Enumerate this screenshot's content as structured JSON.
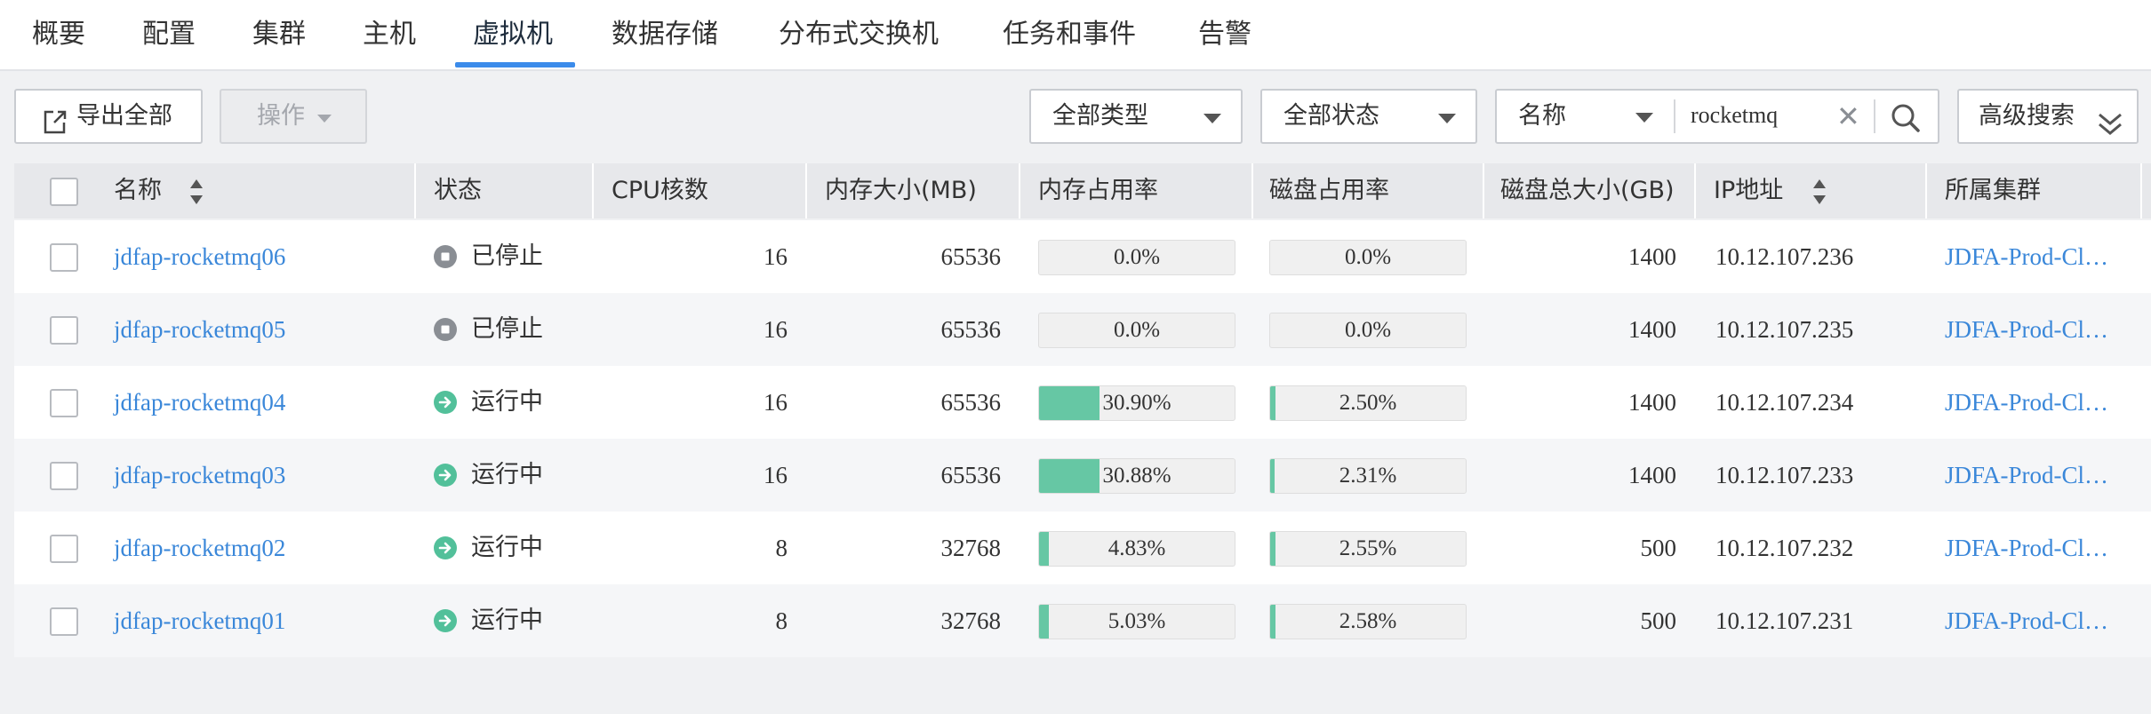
{
  "tabs": [
    "概要",
    "配置",
    "集群",
    "主机",
    "虚拟机",
    "数据存储",
    "分布式交换机",
    "任务和事件",
    "告警"
  ],
  "toolbar": {
    "export_label": "导出全部",
    "operate_label": "操作",
    "type_filter": "全部类型",
    "status_filter": "全部状态",
    "search_field": "名称",
    "search_value": "rocketmq",
    "advanced_search": "高级搜索"
  },
  "table": {
    "headers": [
      "名称",
      "状态",
      "CPU核数",
      "内存大小(MB)",
      "内存占用率",
      "磁盘占用率",
      "磁盘总大小(GB)",
      "IP地址",
      "所属集群"
    ],
    "rows": [
      {
        "name": "jdfap-rocketmq06",
        "status": "已停止",
        "state": "stopped",
        "cpu": "16",
        "mem": "65536",
        "mem_usage": "0.0%",
        "mem_pct": 0,
        "disk_usage": "0.0%",
        "disk_pct": 0,
        "disk_total": "1400",
        "ip": "10.12.107.236",
        "cluster": "JDFA-Prod-Cl…"
      },
      {
        "name": "jdfap-rocketmq05",
        "status": "已停止",
        "state": "stopped",
        "cpu": "16",
        "mem": "65536",
        "mem_usage": "0.0%",
        "mem_pct": 0,
        "disk_usage": "0.0%",
        "disk_pct": 0,
        "disk_total": "1400",
        "ip": "10.12.107.235",
        "cluster": "JDFA-Prod-Cl…"
      },
      {
        "name": "jdfap-rocketmq04",
        "status": "运行中",
        "state": "running",
        "cpu": "16",
        "mem": "65536",
        "mem_usage": "30.90%",
        "mem_pct": 30.9,
        "disk_usage": "2.50%",
        "disk_pct": 2.5,
        "disk_total": "1400",
        "ip": "10.12.107.234",
        "cluster": "JDFA-Prod-Cl…"
      },
      {
        "name": "jdfap-rocketmq03",
        "status": "运行中",
        "state": "running",
        "cpu": "16",
        "mem": "65536",
        "mem_usage": "30.88%",
        "mem_pct": 30.88,
        "disk_usage": "2.31%",
        "disk_pct": 2.31,
        "disk_total": "1400",
        "ip": "10.12.107.233",
        "cluster": "JDFA-Prod-Cl…"
      },
      {
        "name": "jdfap-rocketmq02",
        "status": "运行中",
        "state": "running",
        "cpu": "8",
        "mem": "32768",
        "mem_usage": "4.83%",
        "mem_pct": 4.83,
        "disk_usage": "2.55%",
        "disk_pct": 2.55,
        "disk_total": "500",
        "ip": "10.12.107.232",
        "cluster": "JDFA-Prod-Cl…"
      },
      {
        "name": "jdfap-rocketmq01",
        "status": "运行中",
        "state": "running",
        "cpu": "8",
        "mem": "32768",
        "mem_usage": "5.03%",
        "mem_pct": 5.03,
        "disk_usage": "2.58%",
        "disk_pct": 2.58,
        "disk_total": "500",
        "ip": "10.12.107.231",
        "cluster": "JDFA-Prod-Cl…"
      }
    ]
  },
  "colors": {
    "accent": "#3b8bea",
    "link": "#3a87d9",
    "bar_fill": "#66c7a4",
    "stopped_icon": "#8a8e94",
    "running_icon": "#52c09a"
  },
  "icons": {
    "export": "export-icon",
    "search": "search-icon",
    "clear": "close-icon",
    "advanced": "double-chevron-down-icon",
    "sort": "sort-icon",
    "stopped": "stop-circle-icon",
    "running": "arrow-right-circle-icon"
  }
}
